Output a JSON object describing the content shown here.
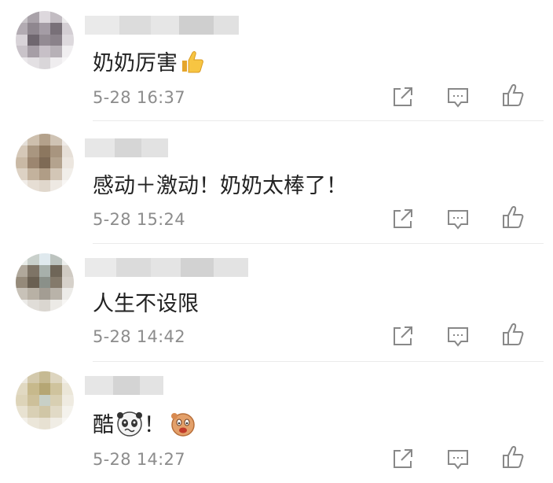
{
  "comments": [
    {
      "content": "奶奶厉害",
      "emoji": "thumbs-up",
      "time": "5-28 16:37"
    },
    {
      "content": "感动＋激动！奶奶太棒了！",
      "time": "5-28 15:24"
    },
    {
      "content": "人生不设限",
      "time": "5-28 14:42"
    },
    {
      "content": "酷",
      "emoji_after": "！",
      "emojis": [
        "panda-face",
        "laughing-blob"
      ],
      "time": "5-28 14:27"
    }
  ],
  "icons": {
    "share": "share-icon",
    "reply": "comment-icon",
    "like": "thumbs-up-icon"
  },
  "colors": {
    "text": "#222222",
    "meta": "#8c8c8c",
    "icon": "#888888",
    "divider": "#ebebeb"
  }
}
